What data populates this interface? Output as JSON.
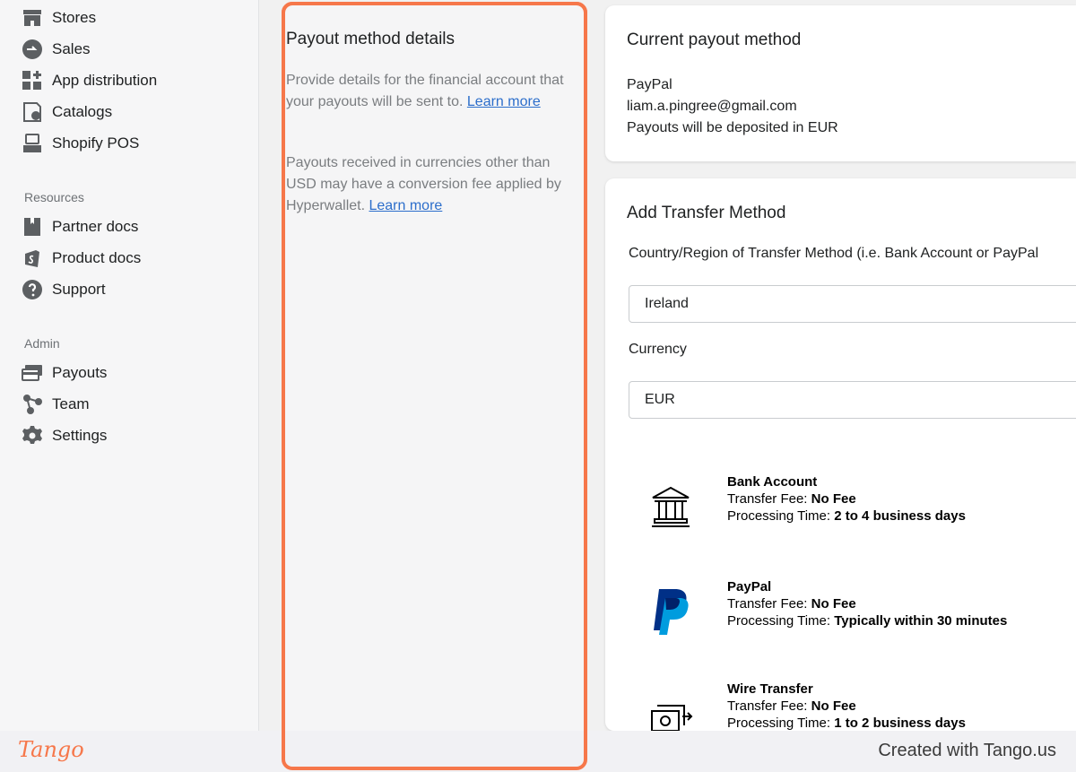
{
  "sidebar": {
    "items": [
      {
        "label": "Stores",
        "icon": "store-icon"
      },
      {
        "label": "Sales",
        "icon": "sales-icon"
      },
      {
        "label": "App distribution",
        "icon": "app-distribution-icon"
      },
      {
        "label": "Catalogs",
        "icon": "catalog-icon"
      },
      {
        "label": "Shopify POS",
        "icon": "pos-icon"
      }
    ],
    "resources_title": "Resources",
    "resources": [
      {
        "label": "Partner docs",
        "icon": "book-icon"
      },
      {
        "label": "Product docs",
        "icon": "shopify-bag-icon"
      },
      {
        "label": "Support",
        "icon": "question-icon"
      }
    ],
    "admin_title": "Admin",
    "admin": [
      {
        "label": "Payouts",
        "icon": "payouts-icon"
      },
      {
        "label": "Team",
        "icon": "team-icon"
      },
      {
        "label": "Settings",
        "icon": "gear-icon"
      }
    ]
  },
  "info": {
    "title": "Payout method details",
    "para1_text": "Provide details for the financial account that your payouts will be sent to. ",
    "para1_link": "Learn more",
    "para2_text": "Payouts received in currencies other than USD may have a conversion fee applied by Hyperwallet. ",
    "para2_link": "Learn more"
  },
  "current": {
    "title": "Current payout method",
    "method": "PayPal",
    "email": "liam.a.pingree@gmail.com",
    "deposit": "Payouts will be deposited in EUR"
  },
  "transfer": {
    "title": "Add Transfer Method",
    "country_label": "Country/Region of Transfer Method (i.e. Bank Account or PayPal",
    "country_value": "Ireland",
    "currency_label": "Currency",
    "currency_value": "EUR",
    "methods": [
      {
        "name": "Bank Account",
        "fee_label": "Transfer Fee:",
        "fee": "No Fee",
        "time_label": "Processing Time:",
        "time": "2 to 4 business days",
        "icon": "bank-icon"
      },
      {
        "name": "PayPal",
        "fee_label": "Transfer Fee:",
        "fee": "No Fee",
        "time_label": "Processing Time:",
        "time": "Typically within 30 minutes",
        "icon": "paypal-icon"
      },
      {
        "name": "Wire Transfer",
        "fee_label": "Transfer Fee:",
        "fee": "No Fee",
        "time_label": "Processing Time:",
        "time": "1 to 2 business days",
        "icon": "wire-transfer-icon"
      }
    ]
  },
  "footer": {
    "logo": "Tango",
    "credit": "Created with Tango.us"
  },
  "colors": {
    "highlight": "#f6774a",
    "link": "#2c6ecb",
    "paypal_dark": "#003087",
    "paypal_light": "#009cde"
  }
}
